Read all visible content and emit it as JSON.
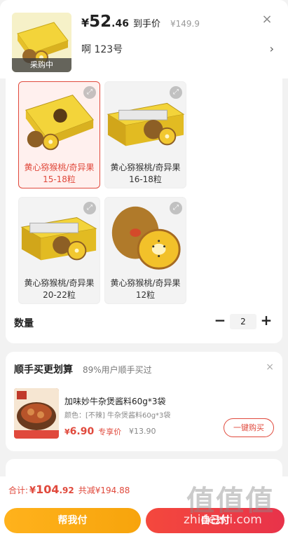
{
  "header": {
    "thumb_tag": "采购中",
    "currency": "¥",
    "price_int": "52",
    "price_dec": ".46",
    "price_suffix": "到手价",
    "orig_price": "¥149.9",
    "close_icon": "close-icon",
    "spec_text": "啊    123号",
    "chevron": "›"
  },
  "options": [
    {
      "label": "黄心猕猴桃/奇异果 15-18粒",
      "selected": true
    },
    {
      "label": "黄心猕猴桃/奇异果 16-18粒",
      "selected": false
    },
    {
      "label": "黄心猕猴桃/奇异果 20-22粒",
      "selected": false
    },
    {
      "label": "黄心猕猴桃/奇异果 12粒",
      "selected": false
    }
  ],
  "quantity": {
    "label": "数量",
    "minus": "−",
    "value": "2",
    "plus": "+"
  },
  "suggestion": {
    "title": "顺手买更划算",
    "subtitle": "89%用户顺手买过",
    "close": "×",
    "product_name": "加味妙牛杂煲酱料60g*3袋",
    "spec": "颜色：[不辣] 牛杂煲酱料60g*3袋",
    "price_cur": "¥",
    "price_val": "6.90",
    "price_label": "专享价",
    "orig_price": "¥13.90",
    "button": "一键购买"
  },
  "bottom": {
    "total_label": "合计:",
    "total_cur": "¥",
    "total_int": "104",
    "total_dec": ".92",
    "sum_text": "共减¥194.88",
    "help_button": "帮我付",
    "self_button": "自己付"
  },
  "watermark": {
    "logo": "值值值",
    "url": "zhidezhi.com"
  },
  "colors": {
    "accent_red": "#e0493c",
    "orange": "#f7a40c",
    "kiwi_yellow": "#f3c22c"
  }
}
